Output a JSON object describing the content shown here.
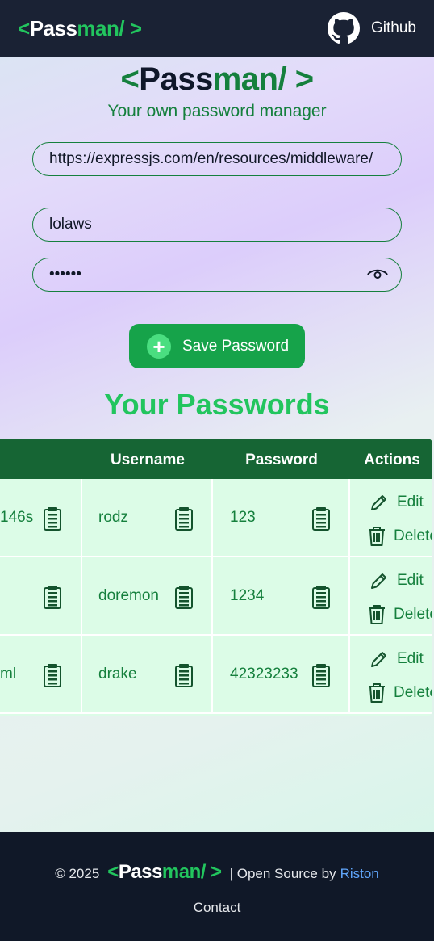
{
  "nav": {
    "logo": {
      "open": "<",
      "part1": "Pass",
      "part2": "man/",
      "close": " >"
    },
    "github_label": "Github"
  },
  "hero": {
    "logo": {
      "open": "<",
      "part1": "Pass",
      "part2": "man/",
      "close": " >"
    },
    "subtitle": "Your own password manager"
  },
  "form": {
    "site_value": "https://expressjs.com/en/resources/middleware/",
    "username_value": "lolaws",
    "password_masked": "••••••"
  },
  "save_button_label": "Save Password",
  "section_title": "Your Passwords",
  "table": {
    "headers": [
      "Username",
      "Password",
      "Actions"
    ],
    "rows": [
      {
        "site": "146s",
        "username": "rodz",
        "password": "123"
      },
      {
        "site": "",
        "username": "doremon",
        "password": "1234"
      },
      {
        "site": "ml",
        "username": "drake",
        "password": "42323233"
      }
    ],
    "edit_label": "Edit",
    "delete_label": "Delete"
  },
  "footer": {
    "copyright": "© 2025",
    "logo": {
      "open": "<",
      "part1": "Pass",
      "part2": "man/",
      "close": " >"
    },
    "open_source": "| Open Source by",
    "author": "Riston",
    "contact": "Contact"
  },
  "colors": {
    "accent": "#16a34a",
    "dark": "#1a2234",
    "table_header": "#166534",
    "table_body": "#dcfce7"
  }
}
